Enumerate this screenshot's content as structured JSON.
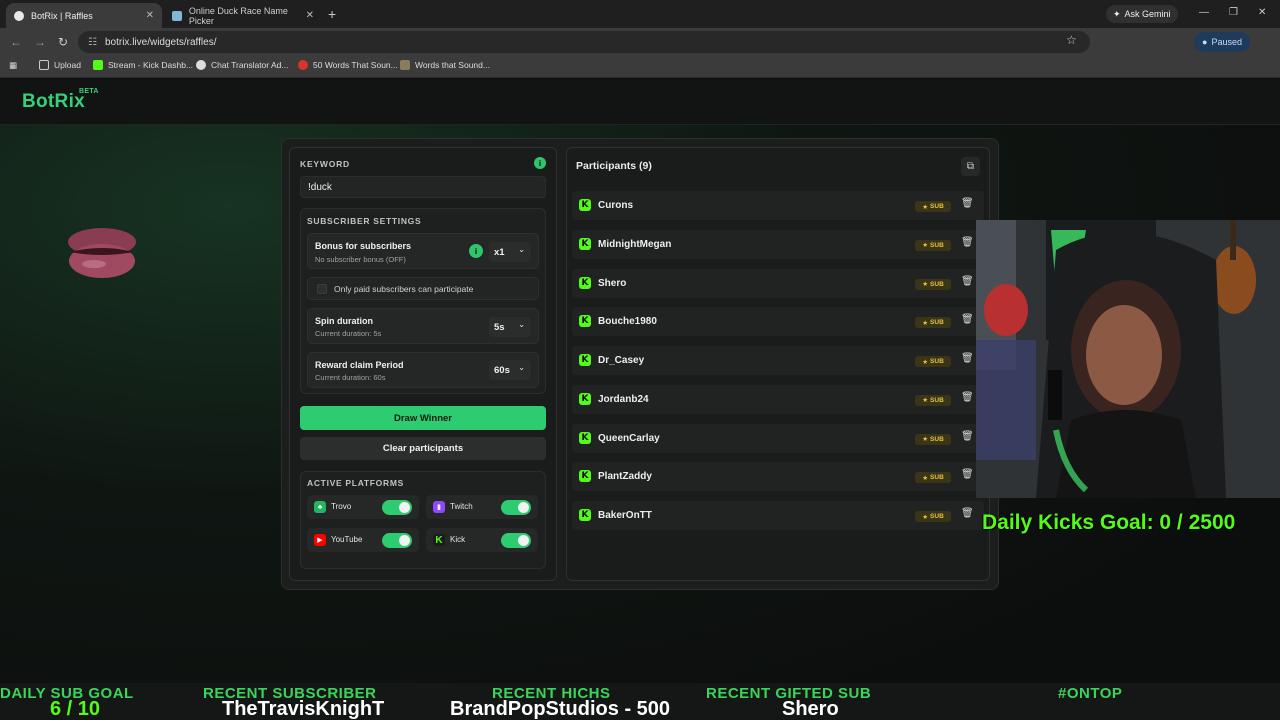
{
  "browser": {
    "tabs": [
      {
        "label": "BotRix | Raffles",
        "active": true
      },
      {
        "label": "Online Duck Race Name Picker",
        "active": false
      }
    ],
    "ask_gemini": "Ask Gemini",
    "url": "botrix.live/widgets/raffles/",
    "profile_status": "Paused",
    "bookmarks": [
      {
        "label": "Upload",
        "icon": "folder-icon"
      },
      {
        "label": "Stream - Kick Dashb...",
        "icon": "kick-icon"
      },
      {
        "label": "Chat Translator Ad...",
        "icon": "translator-icon"
      },
      {
        "label": "50 Words That Soun...",
        "icon": "words-icon"
      },
      {
        "label": "Words that Sound...",
        "icon": "words-icon"
      }
    ]
  },
  "site": {
    "logo": "BotRix",
    "beta": "BETA"
  },
  "raffle": {
    "keyword_label": "KEYWORD",
    "keyword_value": "!duck",
    "subscriber_settings_title": "SUBSCRIBER SETTINGS",
    "bonus_title": "Bonus for subscribers",
    "bonus_sub": "No subscriber bonus (OFF)",
    "bonus_value": "x1",
    "only_paid_label": "Only paid subscribers can participate",
    "spin_title": "Spin duration",
    "spin_sub": "Current duration: 5s",
    "spin_value": "5s",
    "reward_title": "Reward claim Period",
    "reward_sub": "Current duration: 60s",
    "reward_value": "60s",
    "draw_button": "Draw Winner",
    "clear_button": "Clear participants",
    "platforms_title": "ACTIVE PLATFORMS",
    "platforms": [
      {
        "name": "Trovo",
        "enabled": true,
        "color": "#1fb65f"
      },
      {
        "name": "Twitch",
        "enabled": true,
        "color": "#9146ff"
      },
      {
        "name": "YouTube",
        "enabled": true,
        "color": "#ff0000"
      },
      {
        "name": "Kick",
        "enabled": true,
        "color": "#53fc18"
      }
    ]
  },
  "participants": {
    "title": "Participants (9)",
    "badge": "SUB",
    "list": [
      "Curons",
      "MidnightMegan",
      "Shero",
      "Bouche1980",
      "Dr_Casey",
      "Jordanb24",
      "QueenCarlay",
      "PlantZaddy",
      "BakerOnTT"
    ]
  },
  "overlay": {
    "goal_text": "Daily Kicks Goal: 0 / 2500",
    "ticker": [
      {
        "label": "DAILY SUB GOAL",
        "value": "6 / 10"
      },
      {
        "label": "RECENT SUBSCRIBER",
        "value": "TheTravisKnighT"
      },
      {
        "label": "RECENT HICHS",
        "value": "BrandPopStudios - 500"
      },
      {
        "label": "RECENT GIFTED SUB",
        "value": "Shero"
      },
      {
        "label": "#ONTOP",
        "value": ""
      }
    ]
  },
  "colors": {
    "accent": "#2ecc71",
    "kick_green": "#53fc18",
    "sub_badge": "#e7c43a"
  }
}
